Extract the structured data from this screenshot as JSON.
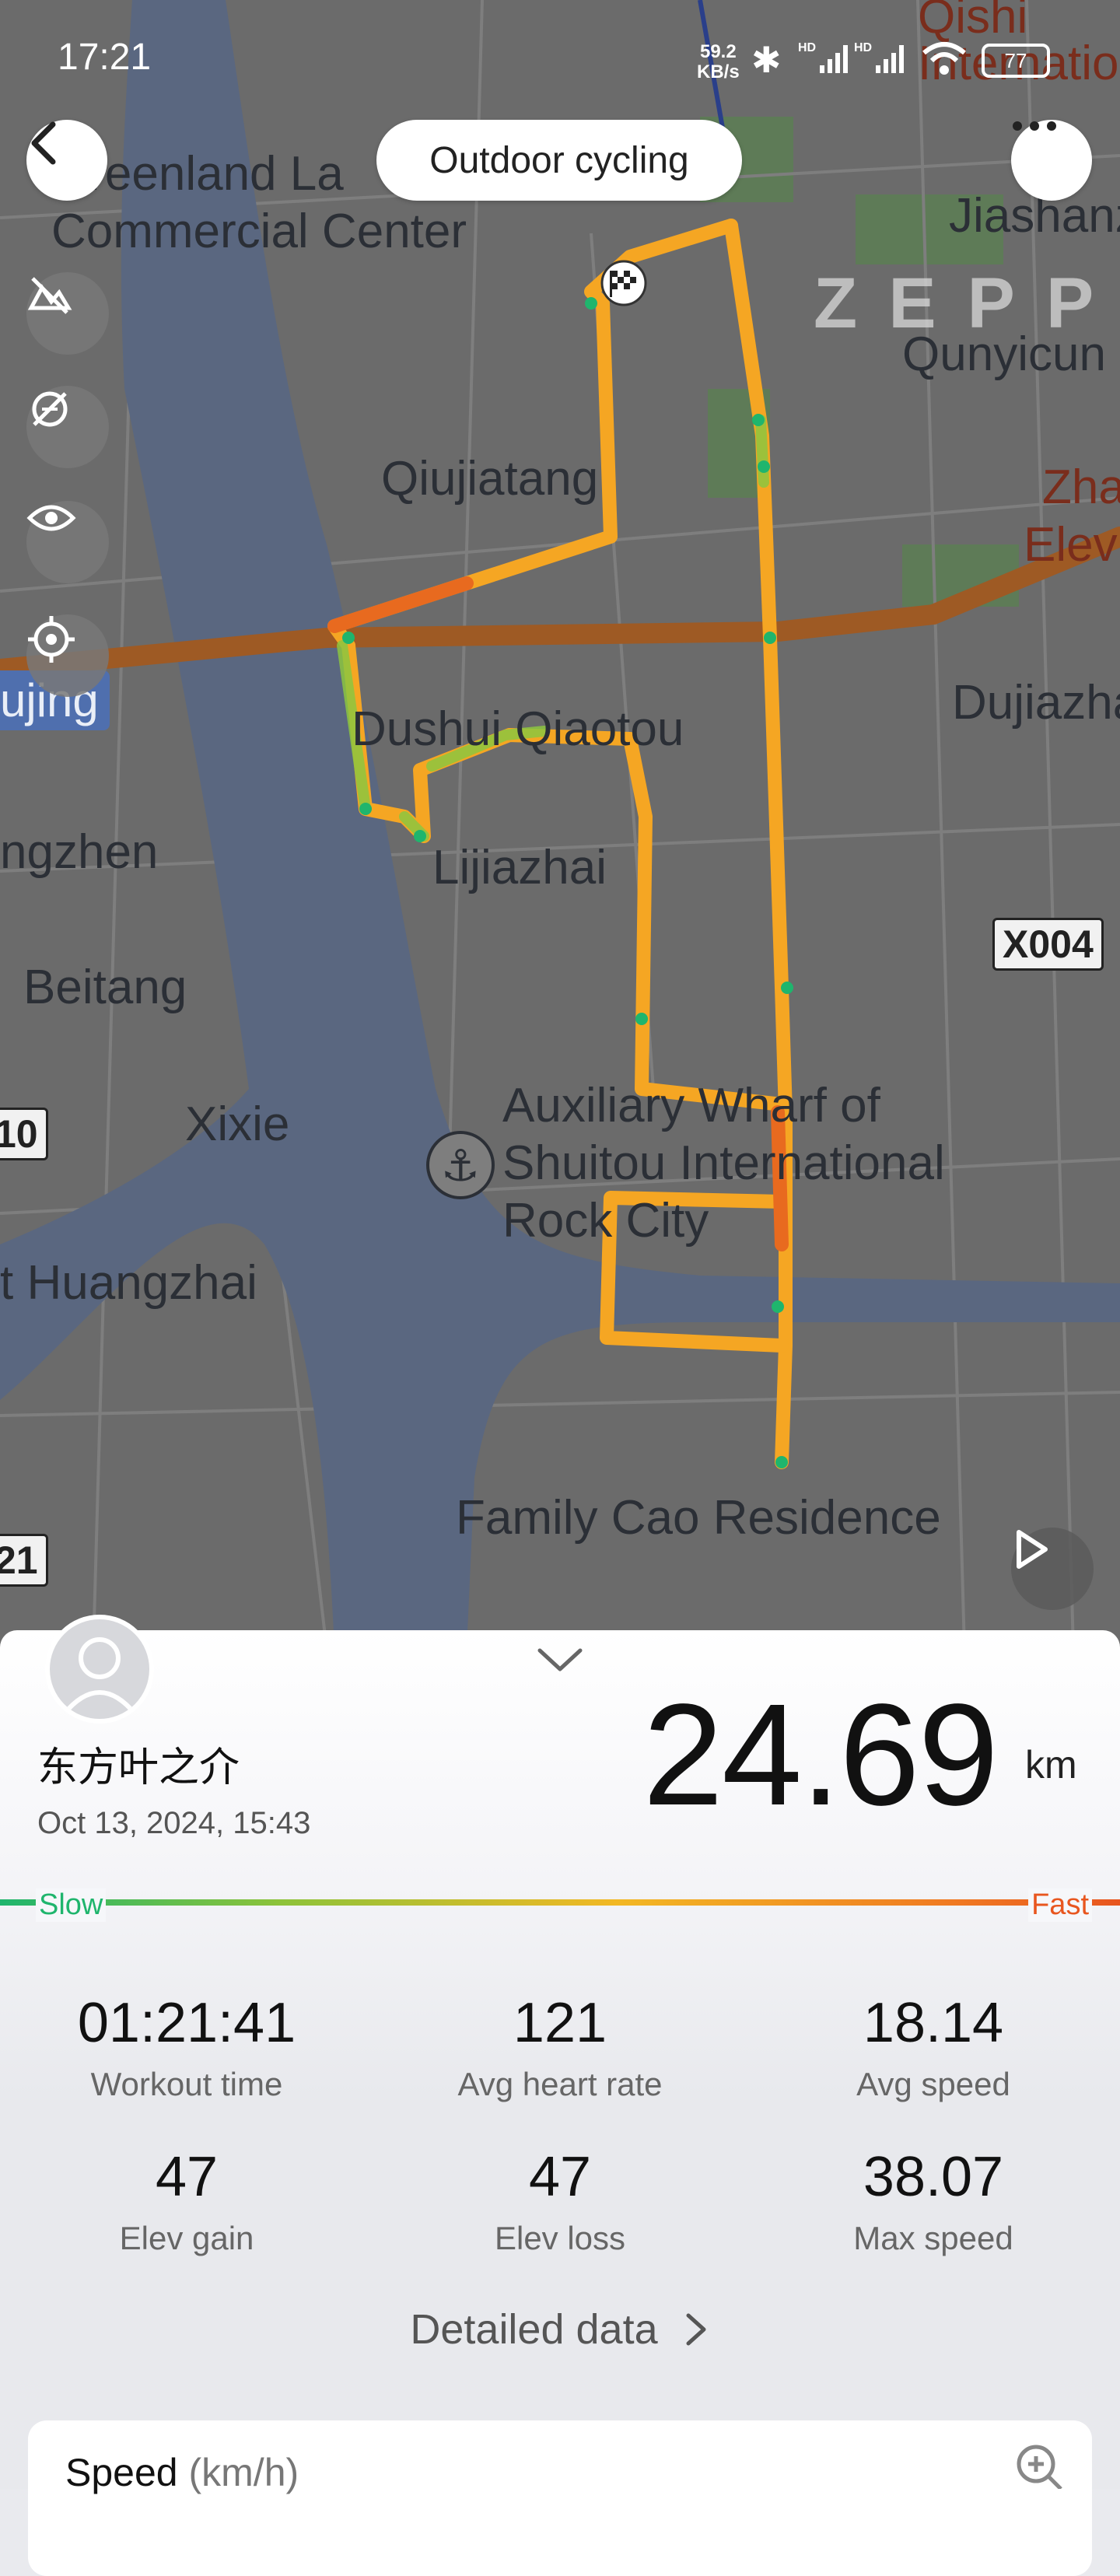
{
  "status_bar": {
    "time": "17:21",
    "net_speed_top": "59.2",
    "net_speed_bottom": "KB/s",
    "battery": "77"
  },
  "header": {
    "title": "Outdoor cycling"
  },
  "brand": "ZEPP",
  "map_labels": {
    "greenland": "Greenland La",
    "commercial": "Commercial Center",
    "qisi": "Qishi",
    "internatio": "Internatio",
    "jiashan": "Jiashanz",
    "qunyicun": "Qunyicun",
    "qiujiatang": "Qiujiatang",
    "zha": "Zha",
    "elev": "Elev",
    "city_badge": "ujing",
    "dujiazha": "Dujiazha",
    "dushui": "Dushui Qiaotou",
    "ngzhen": "ngzhen",
    "lijiazhai": "Lijiazhai",
    "road_x004": "X004",
    "beitang": "Beitang",
    "road_10": "10",
    "xixie": "Xixie",
    "aux1": "Auxiliary Wharf of",
    "aux2": "Shuitou International",
    "aux3": "Rock City",
    "huangzhai": "t Huangzhai",
    "family": "Family Cao Residence",
    "road_21": "21"
  },
  "user": {
    "name": "东方叶之介",
    "date": "Oct 13, 2024, 15:43"
  },
  "summary": {
    "distance": "24.69",
    "unit": "km"
  },
  "speed_scale": {
    "slow": "Slow",
    "fast": "Fast"
  },
  "stats": [
    {
      "value": "01:21:41",
      "label": "Workout time"
    },
    {
      "value": "121",
      "label": "Avg heart rate"
    },
    {
      "value": "18.14",
      "label": "Avg speed"
    },
    {
      "value": "47",
      "label": "Elev gain"
    },
    {
      "value": "47",
      "label": "Elev loss"
    },
    {
      "value": "38.07",
      "label": "Max speed"
    }
  ],
  "detailed_link": "Detailed data",
  "speed_card": {
    "title": "Speed",
    "unit": "(km/h)"
  },
  "colors": {
    "route": "#f5a623",
    "slow": "#1fb56d",
    "fast": "#e8561f",
    "main_road": "#b5651d"
  }
}
